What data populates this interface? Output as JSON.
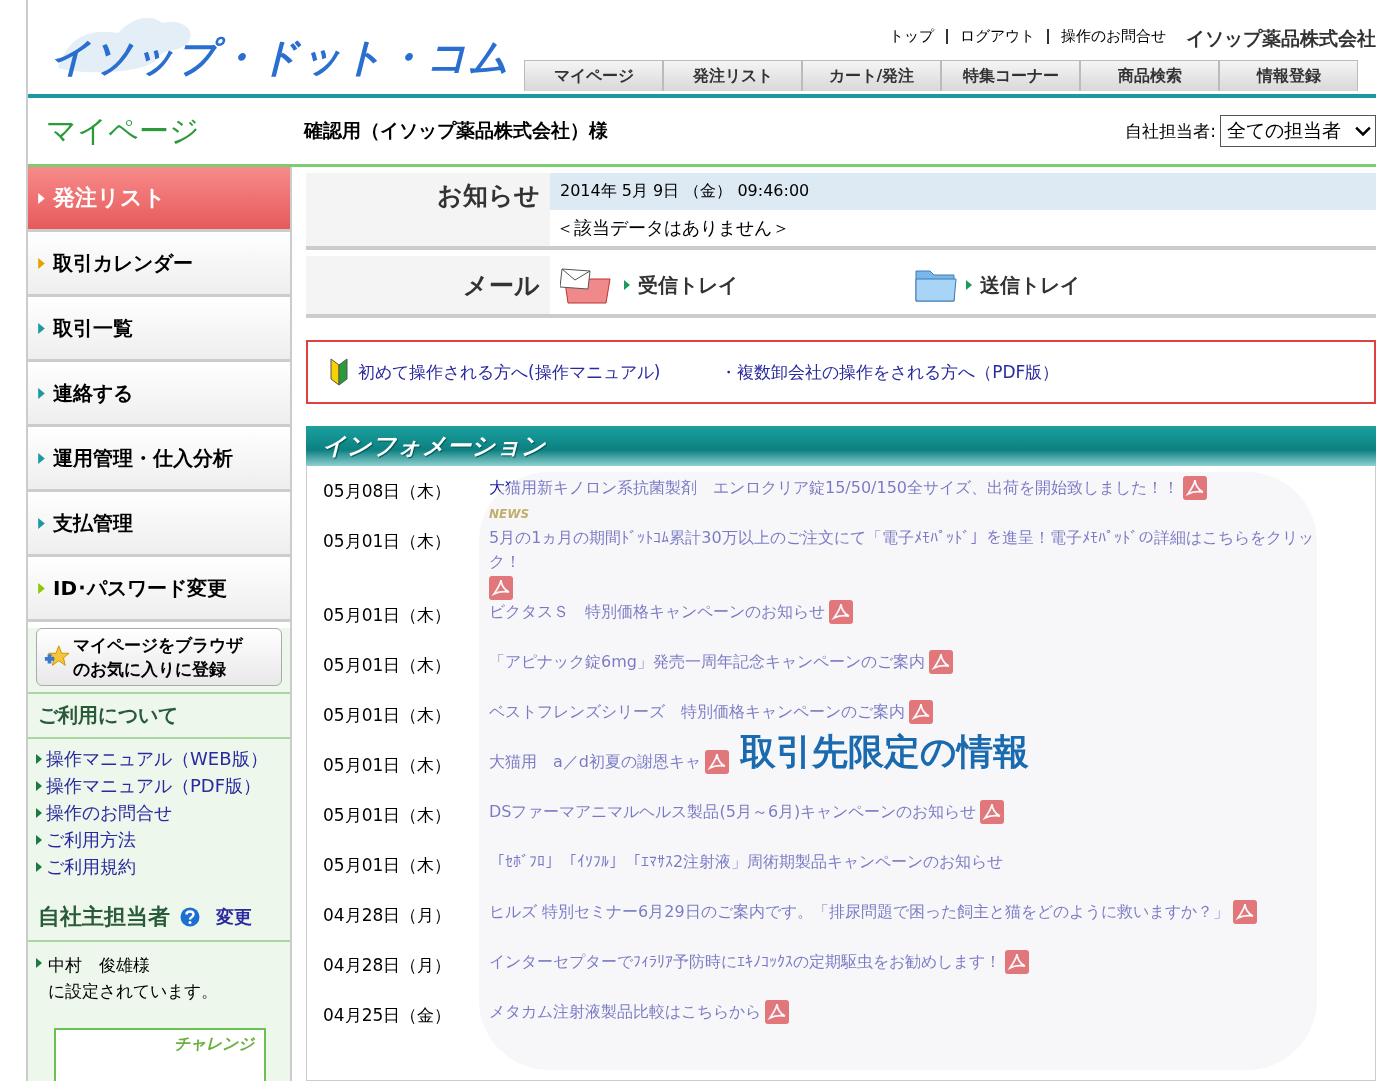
{
  "header": {
    "logo": "イソップ・ドット・コム",
    "top_links": [
      "トップ",
      "ログアウト",
      "操作のお問合せ"
    ],
    "company": "イソップ薬品株式会社",
    "tabs": [
      {
        "label": "マイページ"
      },
      {
        "label": "発注リスト"
      },
      {
        "label": "カート/発注"
      },
      {
        "label": "特集コーナー"
      },
      {
        "label": "商品検索"
      },
      {
        "label": "情報登録"
      }
    ]
  },
  "title_bar": {
    "page_title": "マイページ",
    "customer": "確認用（イソップ薬品株式会社）様",
    "staff_filter": {
      "label": "自社担当者:",
      "value": "全ての担当者"
    }
  },
  "sidebar": {
    "items": [
      {
        "label": "発注リスト",
        "selected": true
      },
      {
        "label": "取引カレンダー",
        "selected": false
      },
      {
        "label": "取引一覧",
        "selected": false
      },
      {
        "label": "連絡する",
        "selected": false
      },
      {
        "label": "運用管理・仕入分析",
        "selected": false
      },
      {
        "label": "支払管理",
        "selected": false
      },
      {
        "label": "ID･パスワード変更",
        "selected": false
      }
    ],
    "favorite_button": [
      "マイページをブラウザ",
      "のお気に入りに登録"
    ],
    "usage": {
      "heading": "ご利用について",
      "links": [
        "操作マニュアル（WEB版）",
        "操作マニュアル（PDF版）",
        "操作のお問合せ",
        "ご利用方法",
        "ご利用規約"
      ]
    },
    "staff": {
      "heading": "自社主担当者",
      "change_link": "変更",
      "lines": [
        "中村　俊雄様",
        "に設定されています。"
      ]
    },
    "banner": "チャレンジ"
  },
  "notice": {
    "label": "お知らせ",
    "datetime": "2014年 5月 9日 （金） 09:46:00",
    "empty": "＜該当データはありません＞"
  },
  "mail": {
    "label": "メール",
    "inbox": "受信トレイ",
    "outbox": "送信トレイ"
  },
  "guide_links": [
    "初めて操作される方へ(操作マニュアル)",
    "・複数卸会社の操作をされる方へ（PDF版）"
  ],
  "information": {
    "title": "インフォメーション",
    "overlay": "取引先限定の情報",
    "items": [
      {
        "date": "05月08日（木）",
        "text": "大猫用新キノロン系抗菌製剤　エンロクリア錠15/50/150全サイズ、出荷を開始致しました！！",
        "pdf": true,
        "news": "NEWS"
      },
      {
        "date": "05月01日（木）",
        "text": "5月の1ヵ月の期間ﾄﾞｯﾄｺﾑ累計30万以上のご注文にて「電子ﾒﾓﾊﾟｯﾄﾞ」を進呈！電子ﾒﾓﾊﾟｯﾄﾞの詳細はこちらをクリック！",
        "pdf": true
      },
      {
        "date": "05月01日（木）",
        "text": "ビクタスＳ　特別価格キャンペーンのお知らせ",
        "pdf": true
      },
      {
        "date": "05月01日（木）",
        "text": "「アピナック錠6mg」発売一周年記念キャンペーンのご案内",
        "pdf": true
      },
      {
        "date": "05月01日（木）",
        "text": "ベストフレンズシリーズ　特別価格キャンペーンのご案内",
        "pdf": true
      },
      {
        "date": "05月01日（木）",
        "text": "大猫用　a／d初夏の謝恩キャ",
        "pdf": true
      },
      {
        "date": "05月01日（木）",
        "text": "DSファーマアニマルヘルス製品(5月～6月)キャンペーンのお知らせ",
        "pdf": true
      },
      {
        "date": "05月01日（木）",
        "text": "「ｾﾎﾞﾌﾛ」「ｲｿﾌﾙ」「ｴﾏｻｽ2注射液」周術期製品キャンペーンのお知らせ",
        "pdf": false
      },
      {
        "date": "04月28日（月）",
        "text": "ヒルズ 特別セミナー6月29日のご案内です。「排尿問題で困った飼主と猫をどのように救いますか？」",
        "pdf": true
      },
      {
        "date": "04月28日（月）",
        "text": "インターセプターでﾌｨﾗﾘｱ予防時にｴｷﾉｺｯｸｽの定期駆虫をお勧めします！",
        "pdf": true
      },
      {
        "date": "04月25日（金）",
        "text": "メタカム注射液製品比較はこちらから",
        "pdf": true
      }
    ]
  }
}
